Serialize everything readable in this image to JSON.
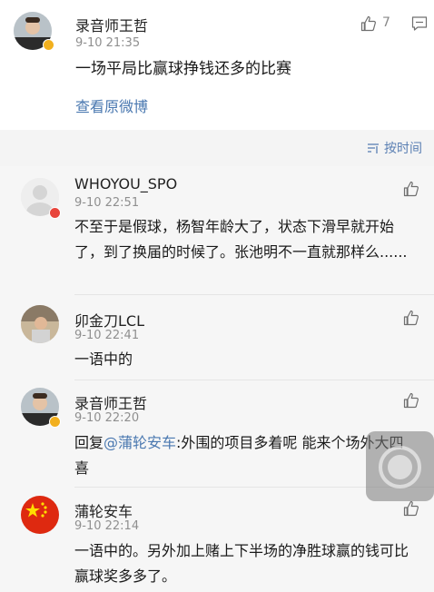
{
  "post": {
    "author": "录音师王哲",
    "time": "9-10 21:35",
    "text": "一场平局比赢球挣钱还多的比赛",
    "like_count": "7",
    "view_original": "查看原微博"
  },
  "sort_label": "按时间",
  "comments": [
    {
      "author": "WHOYOU_SPO",
      "time": "9-10 22:51",
      "text": "不至于是假球，杨智年龄大了，状态下滑早就开始了，到了换届的时候了。张池明不一直就那样么......"
    },
    {
      "author": "卯金刀LCL",
      "time": "9-10 22:41",
      "text": "一语中的"
    },
    {
      "author": "录音师王哲",
      "time": "9-10 22:20",
      "reply_prefix": "回复",
      "mention": "@蒲轮安车",
      "text": ":外围的项目多着呢 能来个场外大四喜"
    },
    {
      "author": "蒲轮安车",
      "time": "9-10 22:14",
      "text": "一语中的。另外加上赌上下半场的净胜球赢的钱可比赢球奖多多了。"
    }
  ],
  "colors": {
    "link": "#4a78b0",
    "verified_badge": "#f2b01e",
    "warning_badge": "#e8453c",
    "flag_red": "#de2910",
    "flag_star": "#ffde00"
  }
}
